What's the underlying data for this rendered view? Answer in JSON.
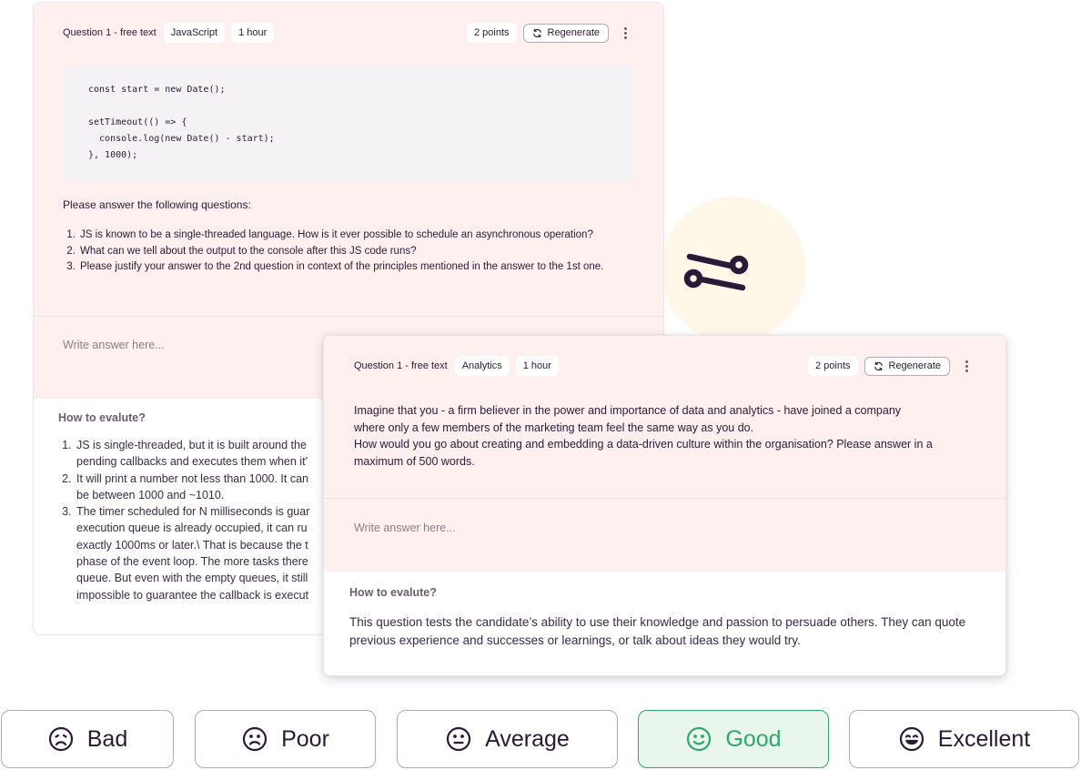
{
  "back_card": {
    "question_label": "Question 1 - free text",
    "tags": [
      "JavaScript",
      "1 hour"
    ],
    "points": "2 points",
    "regenerate_label": "Regenerate",
    "code_lines": [
      "const start = new Date();",
      "",
      "setTimeout(() => {",
      "  console.log(new Date() - start);",
      "}, 1000);"
    ],
    "intro": "Please answer the following questions:",
    "questions": [
      "JS is known to be a single-threaded language. How is it ever possible to schedule an asynchronous operation?",
      "What can we tell about the output to the console after this JS code runs?",
      "Please justify your answer to the 2nd question in context of the principles mentioned in the answer to the 1st one."
    ],
    "answer_placeholder": "Write answer here...",
    "evaluate_title": "How to evalute?",
    "evaluate_items": [
      [
        "JS is single-threaded, but it is built around the",
        "pending callbacks and executes them when it’"
      ],
      [
        "It will print a number not less than 1000. It can",
        "be between 1000 and ~1010."
      ],
      [
        "The timer scheduled for N milliseconds is guar",
        "execution queue is already occupied, it can ru",
        "exactly 1000ms or later.\\ That is because the t",
        "phase of the event loop. The more tasks there",
        "queue. But even with the empty queues, it still",
        "impossible to guarantee the callback is execut"
      ]
    ]
  },
  "front_card": {
    "question_label": "Question 1 - free text",
    "tags": [
      "Analytics",
      "1 hour"
    ],
    "points": "2 points",
    "regenerate_label": "Regenerate",
    "body_lines": [
      "Imagine that you - a firm believer in the power and importance of data and analytics - have joined a company",
      "where only a few members of the marketing team feel the same way as you do.",
      "How would you go about creating and embedding a data-driven culture within the organisation? Please answer in a",
      "maximum of 500 words."
    ],
    "answer_placeholder": "Write answer here...",
    "evaluate_title": "How to evalute?",
    "evaluate_text": "This question tests the candidate’s ability to use their knowledge and passion to persuade others. They can quote previous experience and successes or learnings, or talk about ideas they would try."
  },
  "decoration": {
    "icon": "sliders-icon",
    "circle_color": "#fff7e8"
  },
  "ratings": {
    "selected": "Good",
    "options": [
      {
        "label": "Bad",
        "icon": "sad-face-icon"
      },
      {
        "label": "Poor",
        "icon": "frown-face-icon"
      },
      {
        "label": "Average",
        "icon": "neutral-face-icon"
      },
      {
        "label": "Good",
        "icon": "smile-face-icon"
      },
      {
        "label": "Excellent",
        "icon": "grin-face-icon"
      }
    ]
  },
  "colors": {
    "card_tint": "#fdf0ef",
    "text": "#2a1a35",
    "selected_green": "#2fa86a",
    "selected_bg": "#e8f6ec"
  }
}
